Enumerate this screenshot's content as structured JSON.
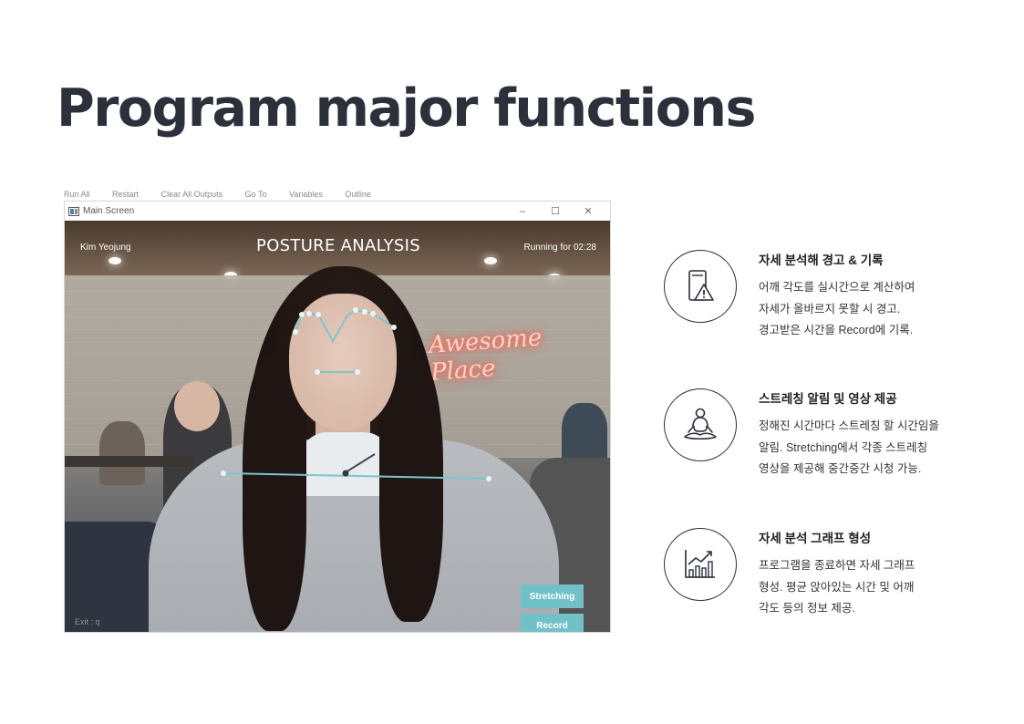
{
  "page": {
    "title": "Program major functions"
  },
  "window": {
    "background_toolbar": [
      "Run All",
      "Restart",
      "Clear All Outputs",
      "Go To",
      "Variables",
      "Outline"
    ],
    "title": "Main Screen",
    "controls": {
      "minimize": "–",
      "maximize": "☐",
      "close": "✕"
    }
  },
  "hud": {
    "user_name": "Kim Yeojung",
    "title": "POSTURE ANALYSIS",
    "timer": "Running for  02:28",
    "exit_hint": "Exit : q",
    "stretching_button": "Stretching",
    "record_button": "Record",
    "neon_sign": "Awesome Place",
    "accent_color": "#72c1c9"
  },
  "features": [
    {
      "icon": "phone-warning-icon",
      "title": "자세 분석해 경고 & 기록",
      "lines": [
        "어깨 각도를 실시간으로 계산하여",
        "자세가 올바르지 못할 시 경고.",
        "경고받은 시간을 Record에 기록."
      ]
    },
    {
      "icon": "meditation-icon",
      "title": "스트레칭 알림 및 영상 제공",
      "lines": [
        "정해진 시간마다 스트레칭 할 시간임을",
        "알림. Stretching에서 각종 스트레칭",
        "영상을 제공해 중간중간 시청 가능."
      ]
    },
    {
      "icon": "growth-chart-icon",
      "title": "자세 분석 그래프 형성",
      "lines": [
        "프로그램을 종료하면 자세 그래프",
        "형성. 평균 앉아있는 시간 및 어깨",
        "각도 등의 정보 제공."
      ]
    }
  ]
}
